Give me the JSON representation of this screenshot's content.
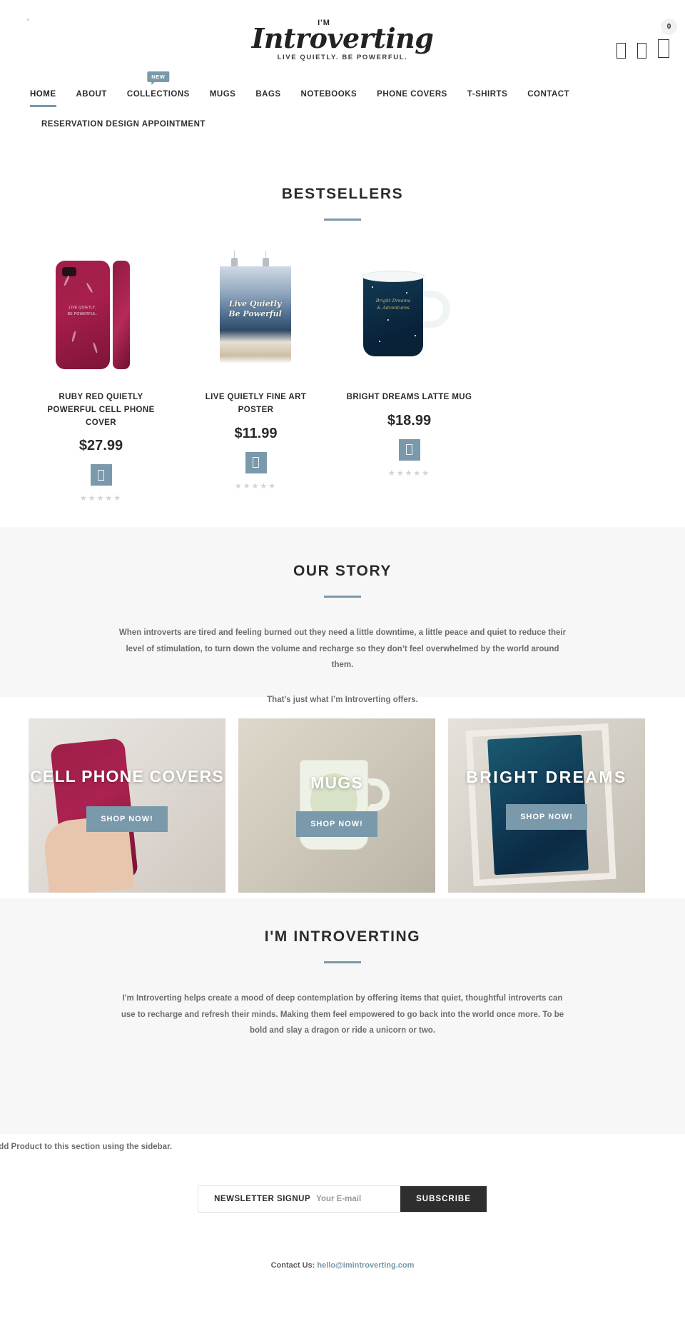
{
  "header": {
    "logo_prefix": "I'M",
    "logo_name": "Introverting",
    "logo_tagline": "LIVE QUIETLY. BE POWERFUL.",
    "icons": [
      {
        "name": "search-icon",
        "glyph": "□"
      },
      {
        "name": "account-icon",
        "glyph": "□"
      },
      {
        "name": "cart-icon",
        "glyph": "□"
      }
    ],
    "cart_count": "0"
  },
  "nav": {
    "row1": [
      {
        "label": "HOME",
        "active": true
      },
      {
        "label": "ABOUT",
        "active": false
      },
      {
        "label": "COLLECTIONS",
        "active": false,
        "badge": "NEW"
      },
      {
        "label": "MUGS",
        "active": false
      },
      {
        "label": "BAGS",
        "active": false
      },
      {
        "label": "NOTEBOOKS",
        "active": false
      },
      {
        "label": "PHONE COVERS",
        "active": false
      },
      {
        "label": "T-SHIRTS",
        "active": false
      },
      {
        "label": "CONTACT",
        "active": false
      }
    ],
    "row2": [
      {
        "label": "RESERVATION DESIGN APPOINTMENT",
        "active": false
      }
    ]
  },
  "bestsellers": {
    "title": "BESTSELLERS",
    "products": [
      {
        "name": "RUBY RED QUIETLY POWERFUL CELL PHONE COVER",
        "price": "$27.99",
        "stars": "★★★★★",
        "rating": 0,
        "cart_glyph": "□",
        "art_caption": "LIVE QUIETLY. BE POWERFUL."
      },
      {
        "name": "LIVE QUIETLY FINE ART POSTER",
        "price": "$11.99",
        "stars": "★★★★★",
        "rating": 0,
        "cart_glyph": "□",
        "art_caption": "Live Quietly\nBe Powerful"
      },
      {
        "name": "BRIGHT DREAMS LATTE MUG",
        "price": "$18.99",
        "stars": "★★★★★",
        "rating": 0,
        "cart_glyph": "□",
        "art_caption": "Bright Dreams\n& Adventures"
      }
    ]
  },
  "story": {
    "title": "OUR STORY",
    "paragraph1": "When introverts are tired and feeling burned out they need a little downtime, a little peace and quiet to reduce their level of stimulation, to turn down the volume and recharge so they don’t feel overwhelmed by the world around them.",
    "paragraph2": "That’s just what I’m Introverting offers."
  },
  "banners": [
    {
      "title": "CELL PHONE COVERS",
      "button": "SHOP NOW!"
    },
    {
      "title": "MUGS",
      "button": "SHOP NOW!"
    },
    {
      "title": "BRIGHT DREAMS",
      "button": "SHOP NOW!"
    }
  ],
  "intro": {
    "title": "I'M INTROVERTING",
    "paragraph": "I'm Introverting helps create a mood of deep contemplation by offering items that quiet, thoughtful introverts can use to recharge and refresh their minds. Making them feel empowered to go back into the world once more. To be bold and slay a dragon or ride a unicorn or two."
  },
  "sidebar_note": "Add Product to this section using the sidebar.",
  "newsletter": {
    "label": "NEWSLETTER SIGNUP",
    "placeholder": "Your E-mail",
    "value": "",
    "button": "SUBSCRIBE"
  },
  "footer": {
    "contact_label": "Contact Us:",
    "email": "hello@imintroverting.com"
  },
  "colors": {
    "accent": "#7a99ab",
    "dark": "#2e2e2e",
    "section_bg": "#f7f7f7",
    "muted_text": "#6d6d6d"
  }
}
